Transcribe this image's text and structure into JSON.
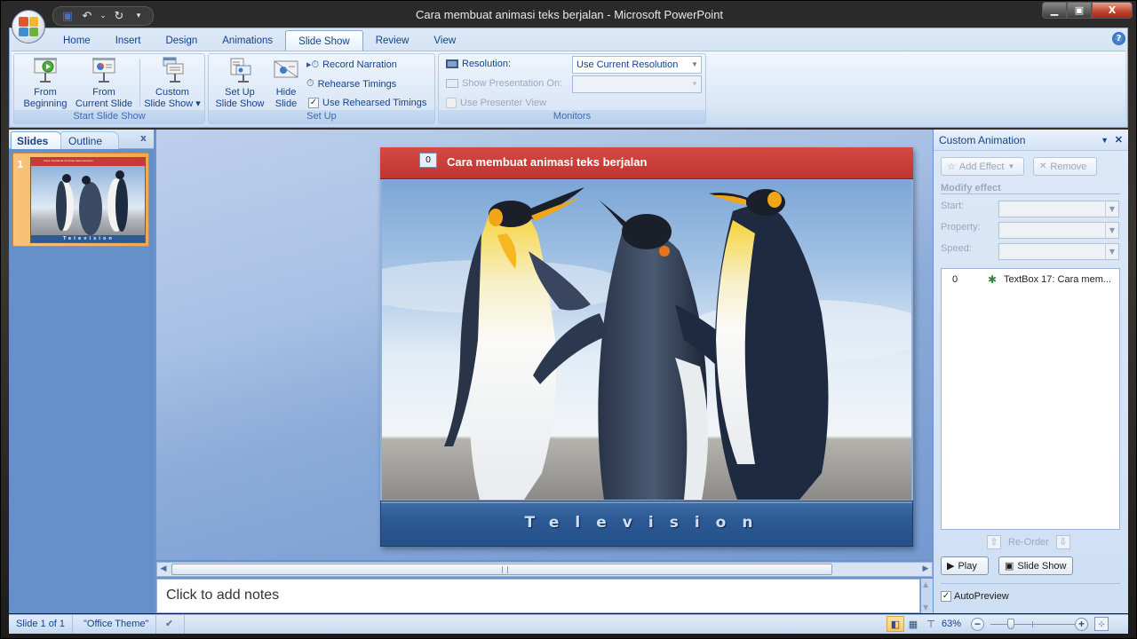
{
  "window": {
    "title": "Cara membuat animasi teks berjalan - Microsoft PowerPoint",
    "controls": {
      "minimize": "–",
      "maximize": "▭",
      "close": "X"
    }
  },
  "quick_access": {
    "icons": [
      "save-icon",
      "undo-icon",
      "redo-icon",
      "customize-icon"
    ],
    "glyphs": {
      "save": "💾",
      "undo": "↶",
      "undo_arrow": "⌄",
      "redo": "↻",
      "customize": "⩡"
    }
  },
  "ribbon": {
    "tabs": [
      {
        "label": "Home",
        "active": false
      },
      {
        "label": "Insert",
        "active": false
      },
      {
        "label": "Design",
        "active": false
      },
      {
        "label": "Animations",
        "active": false
      },
      {
        "label": "Slide Show",
        "active": true
      },
      {
        "label": "Review",
        "active": false
      },
      {
        "label": "View",
        "active": false
      }
    ],
    "help": "?",
    "groups": {
      "start_slide_show": {
        "label": "Start Slide Show",
        "from_beginning": [
          "From",
          "Beginning"
        ],
        "from_current": [
          "From",
          "Current Slide"
        ],
        "custom": [
          "Custom",
          "Slide Show ▾"
        ]
      },
      "set_up": {
        "label": "Set Up",
        "set_up_show": [
          "Set Up",
          "Slide Show"
        ],
        "hide_slide": [
          "Hide",
          "Slide"
        ],
        "record_narration": "Record Narration",
        "rehearse_timings": "Rehearse Timings",
        "use_rehearsed_timings": "Use Rehearsed Timings",
        "use_rehearsed_checked": true
      },
      "monitors": {
        "label": "Monitors",
        "resolution_label": "Resolution:",
        "resolution_value": "Use Current Resolution",
        "show_on_label": "Show Presentation On:",
        "show_on_value": "",
        "presenter_view": "Use Presenter View",
        "presenter_view_checked": false
      }
    }
  },
  "slides_pane": {
    "tabs": [
      {
        "label": "Slides",
        "active": true
      },
      {
        "label": "Outline",
        "active": false
      }
    ],
    "close": "x",
    "thumbnails": [
      {
        "number": "1",
        "selected": true
      }
    ]
  },
  "slide": {
    "animation_tag": "0",
    "title": "Cara membuat animasi teks berjalan",
    "footer_text": "Television",
    "thumb_title": "Cara membuat animasi teks berjalan",
    "thumb_footer": "Television"
  },
  "notes": {
    "placeholder": "Click to add notes"
  },
  "custom_animation": {
    "title": "Custom Animation",
    "add_effect": "Add Effect",
    "remove": "Remove",
    "modify_label": "Modify effect",
    "start_label": "Start:",
    "property_label": "Property:",
    "speed_label": "Speed:",
    "items": [
      {
        "order": "0",
        "name": "TextBox 17: Cara mem..."
      }
    ],
    "reorder_label": "Re-Order",
    "play": "Play",
    "slide_show": "Slide Show",
    "autopreview": "AutoPreview",
    "autopreview_checked": true
  },
  "status_bar": {
    "slide_info": "Slide 1 of 1",
    "theme": "\"Office Theme\"",
    "zoom": "63%",
    "zoom_value_percent": 63,
    "views": [
      "normal-view",
      "slide-sorter-view",
      "slide-show-view"
    ],
    "active_view": "normal-view"
  },
  "colors": {
    "title_bar_red": "#c83a36",
    "footer_blue": "#2c5a94",
    "ribbon_text": "#15428b",
    "selected_thumb": "#f4b35c"
  }
}
